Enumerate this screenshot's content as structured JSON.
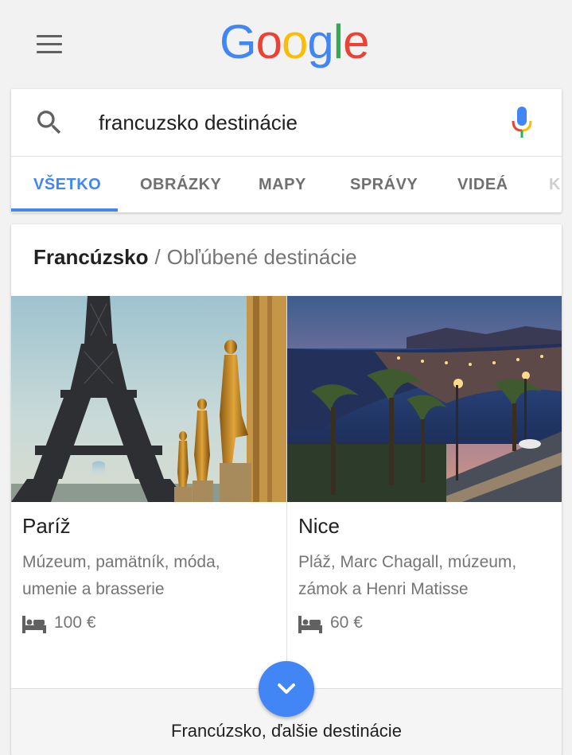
{
  "header": {
    "menu_icon": "hamburger-menu-icon",
    "logo_letters": [
      "G",
      "o",
      "o",
      "g",
      "l",
      "e"
    ],
    "logo_colors": [
      "#4285f4",
      "#ea4335",
      "#fbbc05",
      "#4285f4",
      "#34a853",
      "#ea4335"
    ]
  },
  "search": {
    "query": "francuzsko destinácie",
    "search_icon": "search-icon",
    "mic_icon": "microphone-icon"
  },
  "tabs": [
    {
      "label": "VŠETKO",
      "active": true
    },
    {
      "label": "OBRÁZKY",
      "active": false
    },
    {
      "label": "MAPY",
      "active": false
    },
    {
      "label": "SPRÁVY",
      "active": false
    },
    {
      "label": "VIDEÁ",
      "active": false
    },
    {
      "label": "K",
      "active": false
    }
  ],
  "accent_color": "#4285f4",
  "card": {
    "breadcrumb_main": "Francúzsko",
    "breadcrumb_sep": "/",
    "breadcrumb_sub": "Obľúbené destinácie",
    "destinations": [
      {
        "name": "Paríž",
        "description": "Múzeum, pamätník, móda, umenie a brasserie",
        "price": "100 €",
        "image": "eiffel-tower-photo"
      },
      {
        "name": "Nice",
        "description": "Pláž, Marc Chagall, múzeum, zámok a Henri Matisse",
        "price": "60 €",
        "image": "nice-promenade-night-photo"
      }
    ],
    "footer_label": "Francúzsko, ďalšie destinácie",
    "expand_icon": "chevron-down-icon"
  }
}
